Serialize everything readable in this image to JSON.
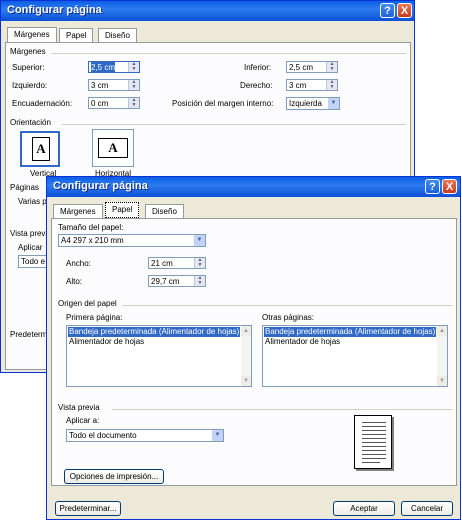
{
  "back_window": {
    "title": "Configurar página",
    "tabs": [
      "Márgenes",
      "Papel",
      "Diseño"
    ],
    "section_margins": "Márgenes",
    "superior": {
      "label": "Superior:",
      "value": "2,5 cm"
    },
    "inferior": {
      "label": "Inferior:",
      "value": "2,5 cm"
    },
    "izquierdo": {
      "label": "Izquierdo:",
      "value": "3 cm"
    },
    "derecho": {
      "label": "Derecho:",
      "value": "3 cm"
    },
    "encuadernacion": {
      "label": "Encuadernación:",
      "value": "0 cm"
    },
    "gutter_position": {
      "label": "Posición del margen interno:",
      "value": "Izquierda"
    },
    "section_orientation": "Orientación",
    "vertical": {
      "label": "Vertical",
      "glyph": "A"
    },
    "horizontal": {
      "label": "Horizontal",
      "glyph": "A"
    },
    "pages_label": "Páginas",
    "multiple_label": "Varias p",
    "preview_label": "Vista previ",
    "apply_label": "Aplicar",
    "apply_value": "Todo e",
    "default_button": "Predeterm"
  },
  "front_window": {
    "title": "Configurar página",
    "tabs": [
      "Márgenes",
      "Papel",
      "Diseño"
    ],
    "paper_size_label": "Tamaño del papel:",
    "paper_size_value": "A4 297 x 210 mm",
    "width": {
      "label": "Ancho:",
      "value": "21 cm"
    },
    "height": {
      "label": "Alto:",
      "value": "29,7 cm"
    },
    "paper_source_label": "Origen del papel",
    "first_page_label": "Primera página:",
    "other_pages_label": "Otras páginas:",
    "first_page_items": [
      "Bandeja predeterminada (Alimentador de hojas)",
      "Alimentador de hojas"
    ],
    "other_pages_items": [
      "Bandeja predeterminada (Alimentador de hojas)",
      "Alimentador de hojas"
    ],
    "preview_label": "Vista previa",
    "apply_label": "Aplicar a:",
    "apply_value": "Todo el documento",
    "print_options_button": "Opciones de impresión...",
    "default_button": "Predeterminar...",
    "ok_button": "Aceptar",
    "cancel_button": "Cancelar"
  },
  "titlebar_buttons": {
    "help": "?",
    "close": "X"
  },
  "colors": {
    "titlebar": "#0a5fe4",
    "selection": "#316ac5",
    "dialog_bg": "#ece9d8"
  }
}
